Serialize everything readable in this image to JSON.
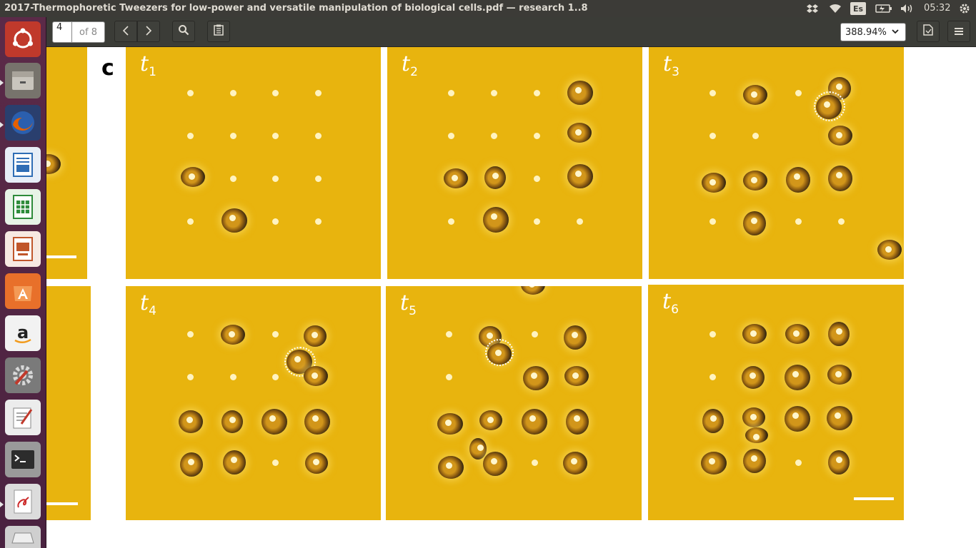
{
  "window": {
    "title": "2017-Thermophoretic Tweezers for low-power and versatile manipulation of biological cells.pdf — research 1..8"
  },
  "tray": {
    "keyboard": "Es",
    "clock": "05:32",
    "icons": [
      "dropbox-icon",
      "wifi-icon",
      "battery-icon",
      "volume-icon",
      "settings-gear-icon"
    ]
  },
  "launcher": {
    "items": [
      {
        "name": "ubuntu-dash-icon",
        "color": "#c0392b"
      },
      {
        "name": "files-icon",
        "color": "#8a8a8a"
      },
      {
        "name": "firefox-icon",
        "color": "#e66000"
      },
      {
        "name": "writer-icon",
        "color": "#2f6db5"
      },
      {
        "name": "calc-icon",
        "color": "#2e8b3a"
      },
      {
        "name": "impress-icon",
        "color": "#c0562b"
      },
      {
        "name": "software-center-icon",
        "color": "#e8702a"
      },
      {
        "name": "amazon-icon",
        "color": "#e6e6e6"
      },
      {
        "name": "system-settings-icon",
        "color": "#9a9a9a"
      },
      {
        "name": "text-editor-icon",
        "color": "#d8d8d8"
      },
      {
        "name": "terminal-icon",
        "color": "#333333"
      },
      {
        "name": "document-viewer-icon",
        "color": "#cc2a2a"
      },
      {
        "name": "drive-icon",
        "color": "#bbbbbb"
      }
    ]
  },
  "toolbar": {
    "page_current": "4",
    "page_total": "of 8",
    "zoom": "388.94%"
  },
  "document": {
    "figure_letter": "c",
    "panels": [
      {
        "label": "t",
        "sub": "1"
      },
      {
        "label": "t",
        "sub": "2"
      },
      {
        "label": "t",
        "sub": "3"
      },
      {
        "label": "t",
        "sub": "4"
      },
      {
        "label": "t",
        "sub": "5"
      },
      {
        "label": "t",
        "sub": "6"
      }
    ]
  },
  "colors": {
    "panel_yellow": "#e8b40e",
    "panel_bar": "#3c3b37",
    "launcher": "#5b2a48"
  }
}
